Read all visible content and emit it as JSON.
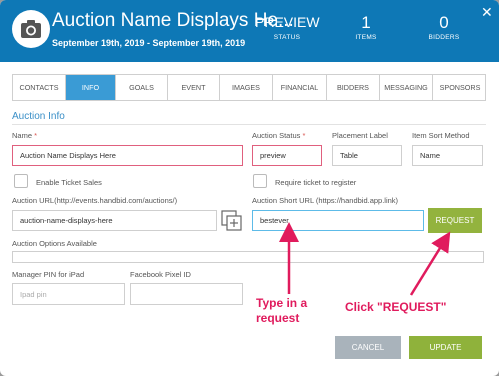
{
  "header": {
    "title": "Auction Name Displays He...",
    "dates": "September 19th, 2019 - September 19th, 2019",
    "preview_label": "PREVIEW",
    "status_label": "STATUS",
    "items_count": "1",
    "items_label": "ITEMS",
    "bidders_count": "0",
    "bidders_label": "BIDDERS",
    "close_icon": "close-icon",
    "logo_icon": "camera-icon"
  },
  "tabs": [
    "CONTACTS",
    "INFO",
    "GOALS",
    "EVENT",
    "IMAGES",
    "FINANCIAL",
    "BIDDERS",
    "MESSAGING",
    "SPONSORS"
  ],
  "active_tab": "INFO",
  "section_title": "Auction Info",
  "form": {
    "name_label": "Name",
    "name_value": "Auction Name Displays Here",
    "status_label": "Auction Status",
    "status_value": "preview",
    "placement_label": "Placement Label",
    "placement_value": "Table",
    "sort_label": "Item Sort Method",
    "sort_value": "Name",
    "ticket_sales_label": "Enable Ticket Sales",
    "require_ticket_label": "Require ticket to register",
    "url_label": "Auction URL(http://events.handbid.com/auctions/)",
    "url_value": "auction-name-displays-here",
    "short_url_label": "Auction Short URL (https://handbid.app.link)",
    "short_url_value": "bestever",
    "request_label": "REQUEST",
    "options_label": "Auction Options Available",
    "pin_label": "Manager PIN for iPad",
    "pin_placeholder": "Ipad pin",
    "pixel_label": "Facebook Pixel ID",
    "cancel_label": "CANCEL",
    "update_label": "UPDATE"
  },
  "annotations": {
    "type_text": "Type in a\nrequest",
    "click_text": "Click \"REQUEST\""
  },
  "colors": {
    "header_blue": "#0e78b6",
    "active_tab": "#3a9bd5",
    "request_green": "#93b33e",
    "update_green": "#8fb23b",
    "cancel_gray": "#a9b3bb",
    "annotation_pink": "#e01b5d"
  }
}
